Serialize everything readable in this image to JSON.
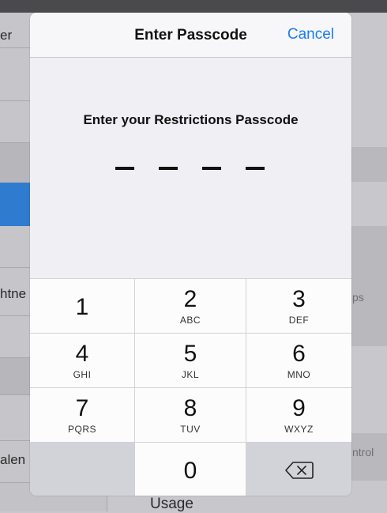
{
  "background": {
    "left_labels": [
      "er",
      "htne",
      "alen"
    ],
    "right_labels": [
      "ps",
      "ntrol"
    ],
    "bottom_label": "Usage"
  },
  "modal": {
    "title": "Enter Passcode",
    "cancel_label": "Cancel",
    "prompt": "Enter your Restrictions Passcode",
    "digits_entered": 0,
    "digits_total": 4
  },
  "keypad": {
    "keys": [
      {
        "digit": "1",
        "letters": ""
      },
      {
        "digit": "2",
        "letters": "ABC"
      },
      {
        "digit": "3",
        "letters": "DEF"
      },
      {
        "digit": "4",
        "letters": "GHI"
      },
      {
        "digit": "5",
        "letters": "JKL"
      },
      {
        "digit": "6",
        "letters": "MNO"
      },
      {
        "digit": "7",
        "letters": "PQRS"
      },
      {
        "digit": "8",
        "letters": "TUV"
      },
      {
        "digit": "9",
        "letters": "WXYZ"
      },
      {
        "digit": "0",
        "letters": ""
      }
    ],
    "backspace_icon": "backspace-icon"
  },
  "colors": {
    "accent": "#1a7cf2",
    "selected_row": "#2f7bd0"
  }
}
